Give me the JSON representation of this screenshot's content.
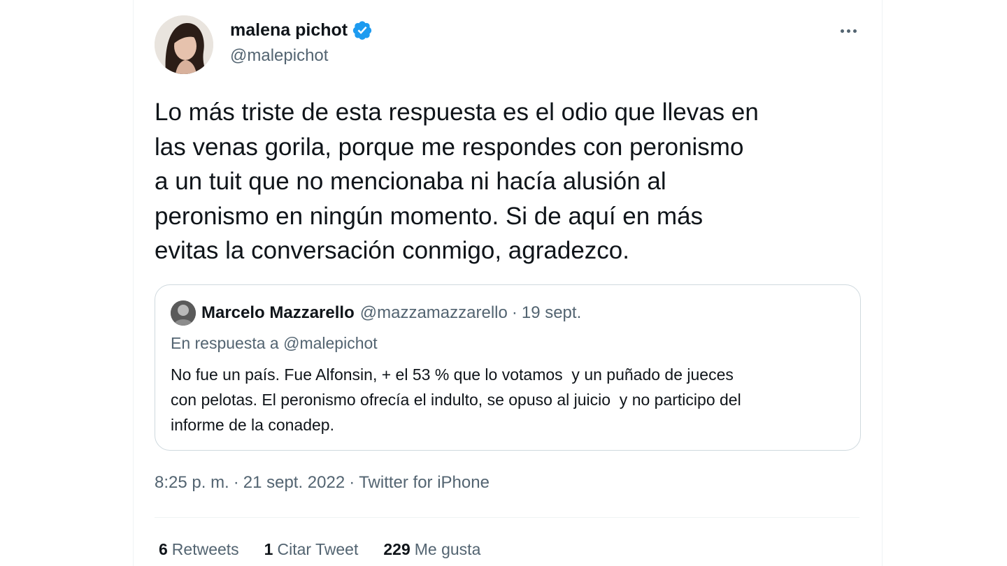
{
  "colors": {
    "text_primary": "#0f1419",
    "text_secondary": "#536471",
    "verified_blue": "#1d9bf0",
    "border": "#cfd9de"
  },
  "author": {
    "name": "malena pichot",
    "handle": "@malepichot",
    "verified_icon": "verified-badge-icon",
    "avatar_icon": "profile-photo"
  },
  "more_icon": "more-options-icon",
  "tweet": {
    "text": "Lo más triste de esta respuesta es el odio que llevas en\nlas venas gorila, porque me respondes con peronismo\na un tuit que no mencionaba ni hacía alusión al\nperonismo en ningún momento. Si de aquí en más\nevitas la conversación conmigo, agradezco."
  },
  "quoted": {
    "name": "Marcelo Mazzarello",
    "handle": "@mazzamazzarello",
    "separator": "·",
    "date": "19 sept.",
    "reply_prefix": "En respuesta a",
    "reply_to": "@malepichot",
    "text": "No fue un país. Fue Alfonsin, + el 53 % que lo votamos  y un puñado de jueces\ncon pelotas. El peronismo ofrecía el indulto, se opuso al juicio  y no participo del\ninforme de la conadep."
  },
  "meta": {
    "time": "8:25 p. m.",
    "sep": "·",
    "date": "21 sept. 2022",
    "source": "Twitter for iPhone"
  },
  "stats": [
    {
      "count": "6",
      "label": "Retweets"
    },
    {
      "count": "1",
      "label": "Citar Tweet"
    },
    {
      "count": "229",
      "label": "Me gusta"
    }
  ]
}
